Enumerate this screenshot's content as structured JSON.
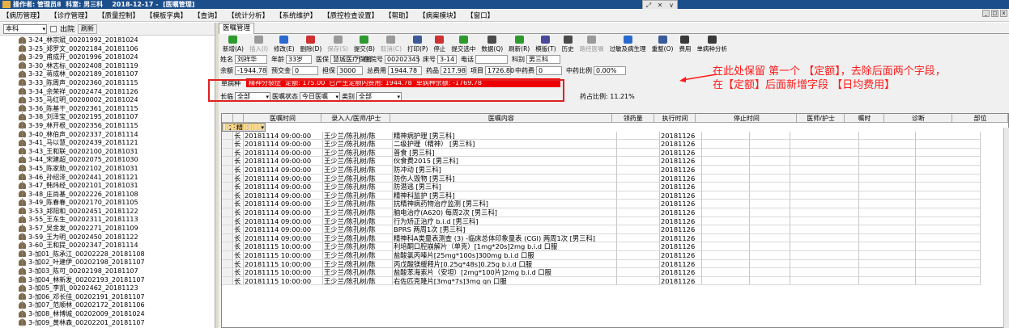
{
  "titlebar": {
    "text": "操作者: 管理员8  科室: 男三科    2018-12-17 -  [医嘱管理]"
  },
  "menu": [
    "【病历管理】",
    "【诊疗管理】",
    "【质量控制】",
    "【模板字典】",
    "【查询】",
    "【统计分析】",
    "【系统维护】",
    "【质控检查设置】",
    "【帮助】",
    "【病案模块】",
    "【窗口】"
  ],
  "left": {
    "dept": "本科",
    "out_label": "出院",
    "refresh": "刷新",
    "tree": [
      "3-24_林宗斌_00201992_20181024",
      "3-25_郑罗文_00202184_20181106",
      "3-29_甫成开_00201996_20181024",
      "3-30_林志标_00202408_20181119",
      "3-32_蒋成林_00202189_20181107",
      "3-33_陈周声_00202360_20181115",
      "3-34_余荣祥_00202474_20181126",
      "3-35_马红明_00200002_20181024",
      "3-36_陈基干_00202361_20181115",
      "3-38_刘泽宝_00202195_20181107",
      "3-39_林开根_00202356_20181115",
      "3-40_林伯声_00202337_20181114",
      "3-41_马以慧_00202439_20181121",
      "3-43_王和联_00202100_20181031",
      "3-44_宋建超_00202075_20181030",
      "3-45_陈家勋_00202102_20181031",
      "3-46_孙绍泽_00202441_20181121",
      "3-47_韩炜经_00202101_20181031",
      "3-48_庄尚基_00202226_20181108",
      "3-49_陈春春_00202170_20181105",
      "3-53_郑阳和_00202451_20181122",
      "3-55_王东生_00202311_20181113",
      "3-57_吴金发_00202271_20181109",
      "3-59_王为明_00202450_20181122",
      "3-60_王和提_00202347_20181114",
      "3-加01_陈承江_00202228_20181108",
      "3-加02_叶建伊_00202198_20181107",
      "3-加03_陈可_00202198_20181107",
      "3-加04_林新发_00202193_20181107",
      "3-加05_李凯_00202462_20181123",
      "3-加06_邓长佳_00202191_20181107",
      "3-加07_范顺林_00202172_20181106",
      "3-加08_林博城_00202009_20181024",
      "3-加09_黄林森_00202201_20181107"
    ]
  },
  "tab": "医嘱管理",
  "toolbar": [
    {
      "label": "新增(A)",
      "color": "#2e9a2e",
      "dis": false
    },
    {
      "label": "插入(I)",
      "color": "#9a9a9a",
      "dis": true
    },
    {
      "label": "修改(E)",
      "color": "#2a6ad0",
      "dis": false
    },
    {
      "label": "删除(D)",
      "color": "#d03030",
      "dis": false
    },
    {
      "label": "保存(S)",
      "color": "#9a9a9a",
      "dis": true
    },
    {
      "label": "提交(B)",
      "color": "#2e9a2e",
      "dis": false
    },
    {
      "label": "取消(C)",
      "color": "#9a9a9a",
      "dis": true
    },
    {
      "label": "打印(P)",
      "color": "#3a5a9a",
      "dis": false
    },
    {
      "label": "停止",
      "color": "#d03030",
      "dis": false
    },
    {
      "label": "提交选中",
      "color": "#2e9a2e",
      "dis": false
    },
    {
      "label": "数据(Q)",
      "color": "#4a4a4a",
      "dis": false
    },
    {
      "label": "刷新(R)",
      "color": "#2e9a2e",
      "dis": false
    },
    {
      "label": "模版(T)",
      "color": "#4a4a9a",
      "dis": false
    },
    {
      "label": "历史",
      "color": "#4a4a4a",
      "dis": false
    },
    {
      "label": "路径医嘱",
      "color": "#9a9a9a",
      "dis": true
    },
    {
      "label": "过敏及病生理",
      "color": "#2a6ad0",
      "dis": false
    },
    {
      "label": "重整(O)",
      "color": "#3a5a9a",
      "dis": false
    },
    {
      "label": "费用",
      "color": "#3a3a3a",
      "dis": false
    },
    {
      "label": "单病种分析",
      "color": "#3a3a3a",
      "dis": false
    }
  ],
  "info1": [
    {
      "l": "姓名",
      "v": "刘祥华"
    },
    {
      "l": "年龄",
      "v": "33岁"
    },
    {
      "l": "医保",
      "v": "慧城医疗保险"
    },
    {
      "l": "住院号",
      "v": "00202345"
    },
    {
      "l": "床号",
      "v": "3-14"
    },
    {
      "l": "电话",
      "v": ""
    },
    {
      "l": "科别",
      "v": "男三科"
    }
  ],
  "info2": [
    {
      "l": "余额",
      "v": "-1944.78"
    },
    {
      "l": "预交金",
      "v": "0"
    },
    {
      "l": "担保",
      "v": "3000"
    },
    {
      "l": "总费用",
      "v": "1944.78"
    },
    {
      "l": "药品",
      "v": "217.98"
    },
    {
      "l": "项目",
      "v": "1726.80"
    },
    {
      "l": "中药费",
      "v": "0"
    },
    {
      "l": "中药比例",
      "v": "0.00%"
    }
  ],
  "alert": {
    "label": "单病种",
    "text": "精神分裂症  定额: 175.00  已产生定额内费用: 1944.78  单病种余额: -1769.78"
  },
  "filter": {
    "l1": "长临",
    "v1": "全部",
    "l2": "医嘱状态",
    "v2": "今日医嘱",
    "l3": "类别",
    "v3": "全部",
    "ratio": "药占比例: 11.21%"
  },
  "grid": {
    "headers": [
      "",
      "",
      "医嘱时间",
      "录入人/医师/护士",
      "医嘱内容",
      "领药量",
      "执行时间",
      "停止时间",
      "医师/护士",
      "嘱时",
      "诊断",
      "部位"
    ],
    "rows": [
      [
        "长",
        "20181114 09:00:00",
        "王少兰/陈孔树/陈",
        "精神科护理常规   [男三科]",
        "",
        "20181126"
      ],
      [
        "长",
        "20181114 09:00:00",
        "王少兰/陈孔树/陈",
        "精神病护理   [男三科]",
        "",
        "20181126"
      ],
      [
        "长",
        "20181114 09:00:00",
        "王少兰/陈孔树/陈",
        "二级护理（精神）   [男三科]",
        "",
        "20181126"
      ],
      [
        "长",
        "20181114 09:00:00",
        "王少兰/陈孔树/陈",
        "普食  [男三科]",
        "",
        "20181126"
      ],
      [
        "长",
        "20181114 09:00:00",
        "王少兰/陈孔树/陈",
        "伙食费2015   [男三科]",
        "",
        "20181126"
      ],
      [
        "长",
        "20181114 09:00:00",
        "王少兰/陈孔树/陈",
        "防冲动   [男三科]",
        "",
        "20181126"
      ],
      [
        "长",
        "20181114 09:00:00",
        "王少兰/陈孔树/陈",
        "防伤人毁物   [男三科]",
        "",
        "20181126"
      ],
      [
        "长",
        "20181114 09:00:00",
        "王少兰/陈孔树/陈",
        "防潜逃   [男三科]",
        "",
        "20181126"
      ],
      [
        "长",
        "20181114 09:00:00",
        "王少兰/陈孔树/陈",
        "精神科监护   [男三科]",
        "",
        "20181126"
      ],
      [
        "长",
        "20181114 09:00:00",
        "王少兰/陈孔树/陈",
        "抗精神病药物治疗监测   [男三科]",
        "",
        "20181126"
      ],
      [
        "长",
        "20181114 09:00:00",
        "王少兰/陈孔树/陈",
        "脑电治疗(A620) 每周2次  [男三科]",
        "",
        "20181126"
      ],
      [
        "长",
        "20181114 09:00:00",
        "王少兰/陈孔树/陈",
        "行为矫正治疗 b.i.d  [男三科]",
        "",
        "20181126"
      ],
      [
        "长",
        "20181114 09:00:00",
        "王少兰/陈孔树/陈",
        "BPRS 两周1次  [男三科]",
        "",
        "20181126"
      ],
      [
        "长",
        "20181114 09:00:00",
        "王少兰/陈孔树/陈",
        "精神科A类量表测查 (3) -临床总体印象量表 (CGI)  两周1次   [男三科]",
        "",
        "20181126"
      ],
      [
        "长",
        "20181115 10:00:00",
        "王少兰/陈孔树/陈",
        "利培酮口腔崩解片（单克）[1mg*20s]2mg b.i.d 口服",
        "",
        "20181126"
      ],
      [
        "长",
        "20181115 10:00:00",
        "王少兰/陈孔树/陈",
        "盐酸氯丙嗪片[25mg*100s]300mg b.i.d 口服",
        "",
        "20181126"
      ],
      [
        "长",
        "20181115 10:00:00",
        "王少兰/陈孔树/陈",
        "丙戊酸镁缓释片[0.25g*48s]0.25g b.i.d 口服",
        "",
        "20181126"
      ],
      [
        "长",
        "20181115 10:00:00",
        "王少兰/陈孔树/陈",
        "盐酸苯海索片（安坦）[2mg*100片]2mg b.i.d 口服",
        "",
        "20181126"
      ],
      [
        "长",
        "20181115 10:00:00",
        "王少兰/陈孔树/陈",
        "右佐匹克隆片[3mg*7s]3mg qn 口服",
        "",
        "20181126"
      ]
    ]
  },
  "annotation": {
    "line1": "在此处保留  第一个    【定额】，去除后面两个字段，",
    "line2": "在【定额】后面新增字段  【日均费用】"
  },
  "colors": {
    "title": "#1c4e8c",
    "alert": "#ee0000",
    "annot": "#ff1a1a",
    "selected": "#fbd889"
  }
}
